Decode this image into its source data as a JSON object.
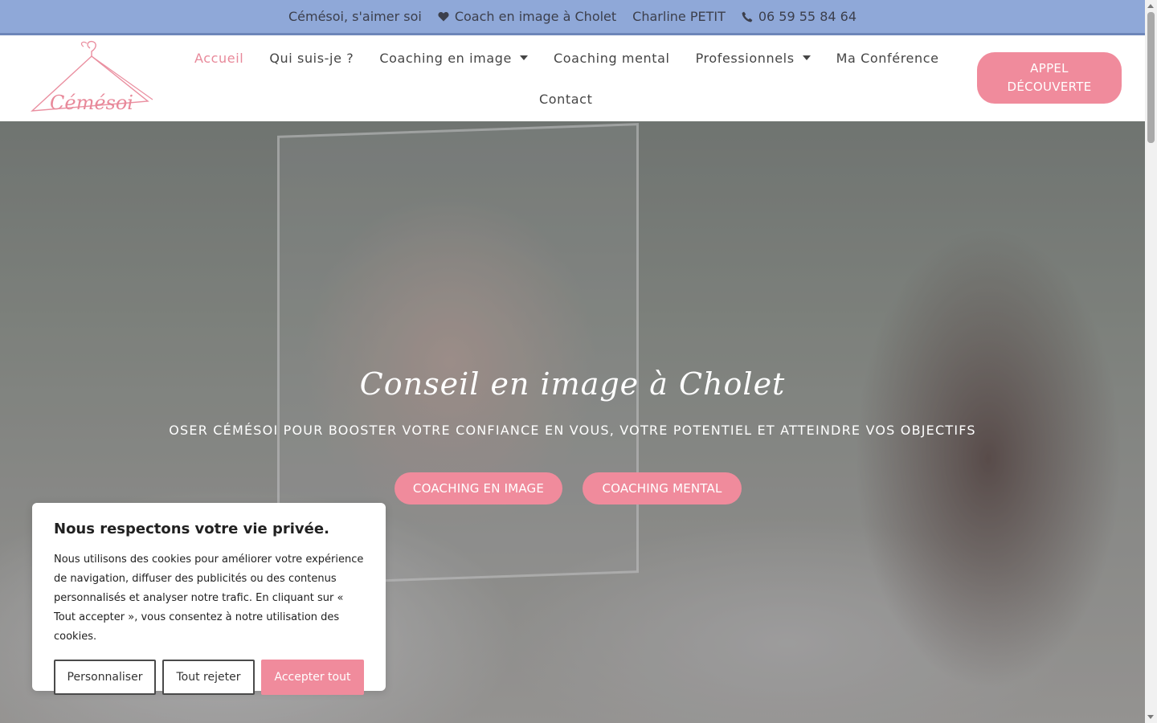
{
  "topbar": {
    "tagline": "Cémésoi, s'aimer soi",
    "coach": "Coach en image à Cholet",
    "name": "Charline PETIT",
    "phone": "06 59 55 84 64",
    "background_color": "#8fa8d8"
  },
  "header": {
    "logo_text": "Cémésoi",
    "nav": {
      "home": "Accueil",
      "about": "Qui suis-je ?",
      "image_coaching": "Coaching en image",
      "mental_coaching": "Coaching mental",
      "professionals": "Professionnels",
      "conference": "Ma Conférence",
      "contact": "Contact"
    },
    "cta_label": "APPEL DÉCOUVERTE",
    "accent_color": "#f08b9c"
  },
  "hero": {
    "title": "Conseil en image à Cholet",
    "subtitle": "OSER CÉMÉSOI POUR BOOSTER VOTRE CONFIANCE EN VOUS, VOTRE POTENTIEL ET ATTEINDRE VOS OBJECTIFS",
    "button_image": "COACHING EN IMAGE",
    "button_mental": "COACHING MENTAL"
  },
  "cookie_banner": {
    "title": "Nous respectons votre vie privée.",
    "body": "Nous utilisons des cookies pour améliorer votre expérience de navigation, diffuser des publicités ou des contenus personnalisés et analyser notre trafic. En cliquant sur « Tout accepter », vous consentez à notre utilisation des cookies.",
    "customize": "Personnaliser",
    "reject": "Tout rejeter",
    "accept": "Accepter tout"
  }
}
